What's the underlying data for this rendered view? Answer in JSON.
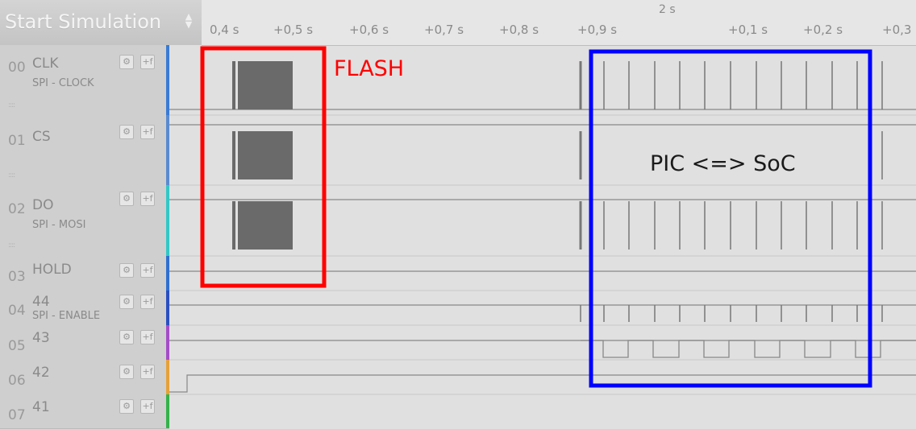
{
  "toolbar": {
    "simulation_label": "Start Simulation",
    "spinner_icon": "chevron-up-down-icon"
  },
  "timeline": {
    "group_label": "2 s",
    "ticks": [
      "0,4 s",
      "+0,5 s",
      "+0,6 s",
      "+0,7 s",
      "+0,8 s",
      "+0,9 s",
      "+0,1 s",
      "+0,2 s",
      "+0,3"
    ]
  },
  "channels": [
    {
      "num": "00",
      "name": "CLK",
      "sub": "SPI - CLOCK",
      "color": "#3a7bd5"
    },
    {
      "num": "01",
      "name": "CS",
      "sub": "",
      "color": "#5b8bd0"
    },
    {
      "num": "02",
      "name": "DO",
      "sub": "SPI - MOSI",
      "color": "#33c7c7"
    },
    {
      "num": "03",
      "name": "HOLD",
      "sub": "",
      "color": "#2f6fd0"
    },
    {
      "num": "04",
      "name": "44",
      "sub": "SPI - ENABLE",
      "color": "#2b4fc0"
    },
    {
      "num": "05",
      "name": "43",
      "sub": "",
      "color": "#a54cc7"
    },
    {
      "num": "06",
      "name": "42",
      "sub": "",
      "color": "#e5a13a"
    },
    {
      "num": "07",
      "name": "41",
      "sub": "",
      "color": "#35b24a"
    }
  ],
  "annotations": {
    "flash_label": "FLASH",
    "pic_label": "PIC <=> SoC",
    "flash_color": "#ff0000",
    "pic_color": "#0000ff"
  }
}
